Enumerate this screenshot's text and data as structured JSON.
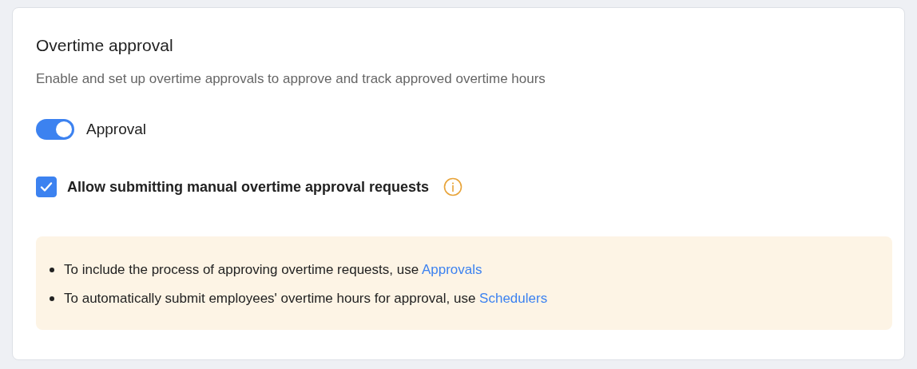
{
  "title": "Overtime approval",
  "description": "Enable and set up overtime approvals to approve and track approved overtime hours",
  "approval_toggle": {
    "label": "Approval",
    "on": true
  },
  "manual_requests": {
    "label": "Allow submitting manual overtime approval requests",
    "checked": true
  },
  "notes": [
    {
      "text": "To include the process of approving overtime requests, use ",
      "link": "Approvals"
    },
    {
      "text": "To automatically submit employees' overtime hours for approval, use ",
      "link": "Schedulers"
    }
  ]
}
